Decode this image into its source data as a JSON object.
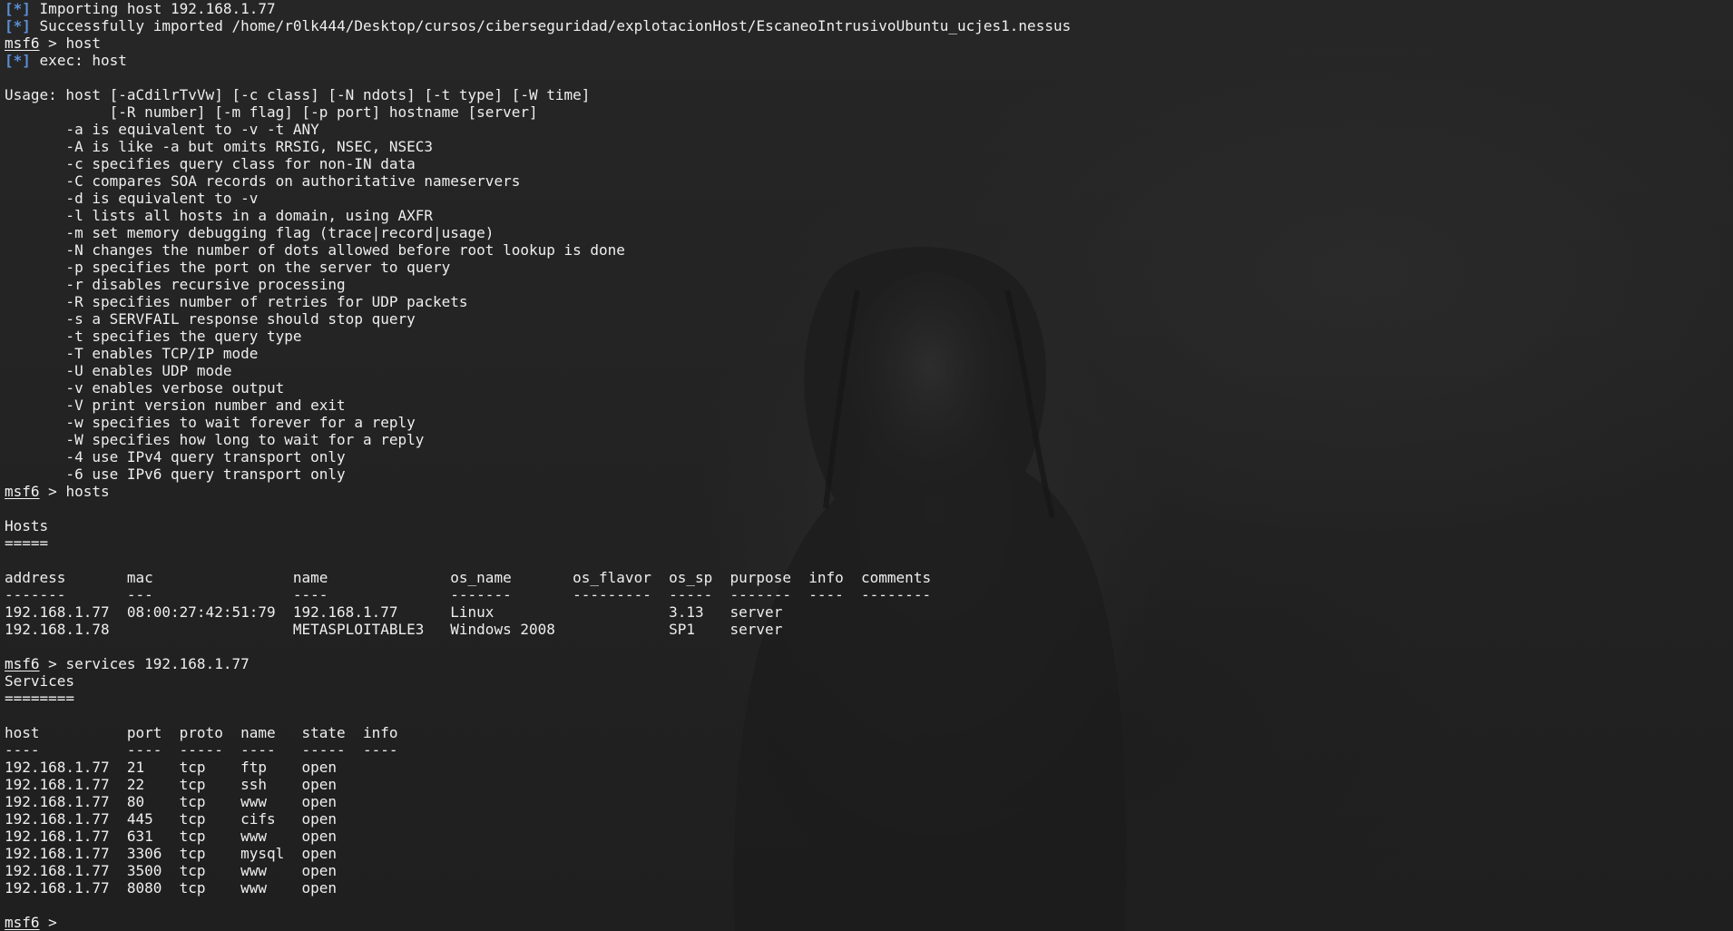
{
  "terminal": {
    "prompt": "msf6",
    "tag": "[*]",
    "lines": [
      {
        "kind": "status",
        "text": "Importing host 192.168.1.77"
      },
      {
        "kind": "status",
        "text": "Successfully imported /home/r0lk444/Desktop/cursos/ciberseguridad/explotacionHost/EscaneoIntrusivoUbuntu_ucjes1.nessus"
      },
      {
        "kind": "command",
        "text": "host"
      },
      {
        "kind": "status",
        "text": "exec: host"
      },
      {
        "kind": "text",
        "text": ""
      },
      {
        "kind": "text",
        "text": "Usage: host [-aCdilrTvVw] [-c class] [-N ndots] [-t type] [-W time]"
      },
      {
        "kind": "text",
        "text": "            [-R number] [-m flag] [-p port] hostname [server]"
      },
      {
        "kind": "text",
        "text": "       -a is equivalent to -v -t ANY"
      },
      {
        "kind": "text",
        "text": "       -A is like -a but omits RRSIG, NSEC, NSEC3"
      },
      {
        "kind": "text",
        "text": "       -c specifies query class for non-IN data"
      },
      {
        "kind": "text",
        "text": "       -C compares SOA records on authoritative nameservers"
      },
      {
        "kind": "text",
        "text": "       -d is equivalent to -v"
      },
      {
        "kind": "text",
        "text": "       -l lists all hosts in a domain, using AXFR"
      },
      {
        "kind": "text",
        "text": "       -m set memory debugging flag (trace|record|usage)"
      },
      {
        "kind": "text",
        "text": "       -N changes the number of dots allowed before root lookup is done"
      },
      {
        "kind": "text",
        "text": "       -p specifies the port on the server to query"
      },
      {
        "kind": "text",
        "text": "       -r disables recursive processing"
      },
      {
        "kind": "text",
        "text": "       -R specifies number of retries for UDP packets"
      },
      {
        "kind": "text",
        "text": "       -s a SERVFAIL response should stop query"
      },
      {
        "kind": "text",
        "text": "       -t specifies the query type"
      },
      {
        "kind": "text",
        "text": "       -T enables TCP/IP mode"
      },
      {
        "kind": "text",
        "text": "       -U enables UDP mode"
      },
      {
        "kind": "text",
        "text": "       -v enables verbose output"
      },
      {
        "kind": "text",
        "text": "       -V print version number and exit"
      },
      {
        "kind": "text",
        "text": "       -w specifies to wait forever for a reply"
      },
      {
        "kind": "text",
        "text": "       -W specifies how long to wait for a reply"
      },
      {
        "kind": "text",
        "text": "       -4 use IPv4 query transport only"
      },
      {
        "kind": "text",
        "text": "       -6 use IPv6 query transport only"
      },
      {
        "kind": "command",
        "text": "hosts"
      },
      {
        "kind": "text",
        "text": ""
      },
      {
        "kind": "text",
        "text": "Hosts"
      },
      {
        "kind": "text",
        "text": "====="
      },
      {
        "kind": "text",
        "text": ""
      },
      {
        "kind": "text",
        "text": "address       mac                name              os_name       os_flavor  os_sp  purpose  info  comments"
      },
      {
        "kind": "text",
        "text": "-------       ---                ----              -------       ---------  -----  -------  ----  --------"
      },
      {
        "kind": "text",
        "text": "192.168.1.77  08:00:27:42:51:79  192.168.1.77      Linux                    3.13   server"
      },
      {
        "kind": "text",
        "text": "192.168.1.78                     METASPLOITABLE3   Windows 2008             SP1    server"
      },
      {
        "kind": "text",
        "text": ""
      },
      {
        "kind": "command",
        "text": "services 192.168.1.77"
      },
      {
        "kind": "text",
        "text": "Services"
      },
      {
        "kind": "text",
        "text": "========"
      },
      {
        "kind": "text",
        "text": ""
      },
      {
        "kind": "text",
        "text": "host          port  proto  name   state  info"
      },
      {
        "kind": "text",
        "text": "----          ----  -----  ----   -----  ----"
      },
      {
        "kind": "text",
        "text": "192.168.1.77  21    tcp    ftp    open"
      },
      {
        "kind": "text",
        "text": "192.168.1.77  22    tcp    ssh    open"
      },
      {
        "kind": "text",
        "text": "192.168.1.77  80    tcp    www    open"
      },
      {
        "kind": "text",
        "text": "192.168.1.77  445   tcp    cifs   open"
      },
      {
        "kind": "text",
        "text": "192.168.1.77  631   tcp    www    open"
      },
      {
        "kind": "text",
        "text": "192.168.1.77  3306  tcp    mysql  open"
      },
      {
        "kind": "text",
        "text": "192.168.1.77  3500  tcp    www    open"
      },
      {
        "kind": "text",
        "text": "192.168.1.77  8080  tcp    www    open"
      },
      {
        "kind": "text",
        "text": ""
      },
      {
        "kind": "command",
        "text": ""
      }
    ]
  },
  "colors": {
    "background": "#232323",
    "foreground": "#eeeeee",
    "status_tag": "#5d8fd8"
  }
}
